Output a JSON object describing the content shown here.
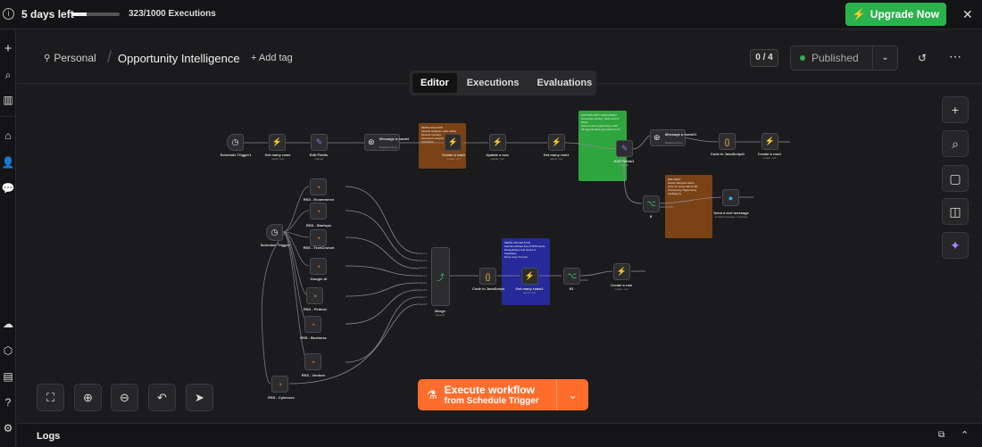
{
  "banner": {
    "days_left": "5 days left",
    "executions_used": 323,
    "executions_total": 1000,
    "executions_text": "323/1000 Executions",
    "upgrade_label": "Upgrade Now",
    "close_glyph": "✕"
  },
  "header": {
    "project": "Personal",
    "workflow_name": "Opportunity Intelligence",
    "add_tag": "+ Add tag",
    "counter": "0 / 4",
    "published_label": "Published"
  },
  "tabs": [
    "Editor",
    "Executions",
    "Evaluations"
  ],
  "active_tab": 0,
  "nodes": {
    "schedule1": {
      "label": "Schedule Trigger1",
      "sub": ""
    },
    "getmany1": {
      "label": "Get many rows",
      "sub": "getAll: row"
    },
    "editfields1": {
      "label": "Edit Fields",
      "sub": "manual"
    },
    "message1": {
      "label": "Message a model",
      "sub": "Response Fee"
    },
    "createrow1": {
      "label": "Create a row1",
      "sub": "create: row"
    },
    "updaterow": {
      "label": "Update a row",
      "sub": "update: row"
    },
    "getmany2": {
      "label": "Get many row1",
      "sub": "getAll: row"
    },
    "editfields2": {
      "label": "Edit Fields1",
      "sub": "manual"
    },
    "message2": {
      "label": "Message a model1",
      "sub": "Response Fee"
    },
    "codejs1": {
      "label": "Code in JavaScript1",
      "sub": ""
    },
    "createrow2": {
      "label": "Create a row1",
      "sub": "create: row"
    },
    "if1": {
      "label": "If",
      "sub": ""
    },
    "sendmsg": {
      "label": "Send a text message",
      "sub": "send&it:message: message"
    },
    "schedule2": {
      "label": "Schedule Trigger",
      "sub": ""
    },
    "rss_ecom": {
      "label": "RSS - Ecommerce",
      "sub": ""
    },
    "rss_startups": {
      "label": "RSS - Startups",
      "sub": ""
    },
    "rss_tech": {
      "label": "RSS - TechCrunch",
      "sub": ""
    },
    "rss_google": {
      "label": "Google AI",
      "sub": ""
    },
    "rss_fintech": {
      "label": "RSS - Fintech",
      "sub": ""
    },
    "rss_business": {
      "label": "RSS - Business",
      "sub": ""
    },
    "rss_venture": {
      "label": "RSS - Venture",
      "sub": ""
    },
    "rss_cyber": {
      "label": "RSS - Cybersec",
      "sub": ""
    },
    "merge": {
      "label": "Merge",
      "sub": "append"
    },
    "codejs2": {
      "label": "Code in JavaScript",
      "sub": ""
    },
    "getmany3": {
      "label": "Get many rows2",
      "sub": "getAll: row"
    },
    "if2": {
      "label": "If1",
      "sub": ""
    },
    "createrow3": {
      "label": "Create a row",
      "sub": "create: row"
    }
  },
  "merge_inputs": [
    "Input 1",
    "Input 2",
    "Input 3",
    "Input 4",
    "Input 5",
    "Input 6",
    "Input 7",
    "Input 8"
  ],
  "stickies": {
    "news_analysis": "NEWS ANALYSIS\nOpenAI analyzes each article\nDetects trending\nSentiment analysis\nSupabase",
    "opportunity": "OPPORTUNITY DISCOVERY\nGenerates startup, SaaS and AI ideas\nScores each opportunity 1-100\nAll opportunities generated on AI",
    "delivery": "DELIVERY\nSends Telegram alerts\nOnly for scores above 80\nPowered by Opportunity Intelligence",
    "news_collection": "NEWS COLLECTION\nFetches articles from 8 RSS feeds\nDeduplicates and stores in Supabase\nRuns every 6 hours"
  },
  "execute": {
    "line1": "Execute workflow",
    "line2": "from Schedule Trigger"
  },
  "logs": {
    "label": "Logs"
  },
  "colors": {
    "accent_orange": "#ff6d2d",
    "upgrade_green": "#2ab24c",
    "sticky_brown": "#7a4215",
    "sticky_green": "#2fa53e",
    "sticky_blue": "#25299a",
    "rss_orange": "#e8772e",
    "lightning_green": "#3ecf6e"
  }
}
